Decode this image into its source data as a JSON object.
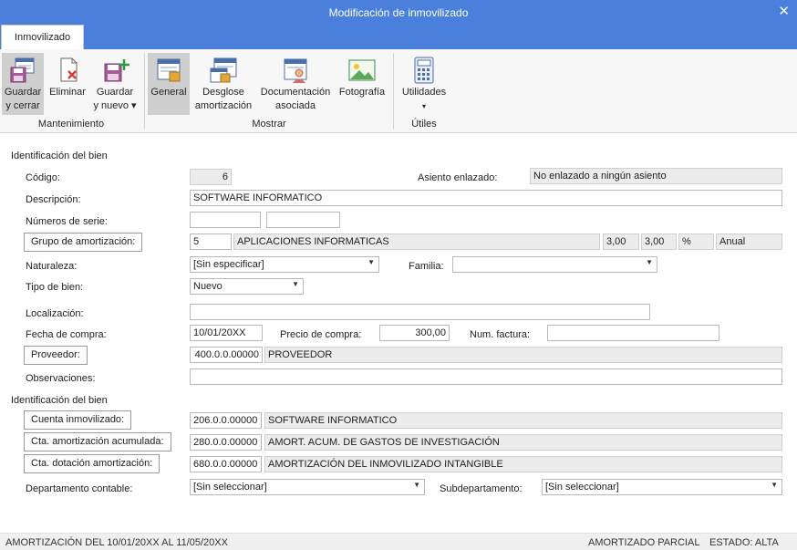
{
  "window": {
    "title": "Modificación de inmovilizado",
    "close_glyph": "✕"
  },
  "tabs": [
    {
      "label": "Inmovilizado"
    }
  ],
  "ribbon": {
    "groups": {
      "mantenimiento": "Mantenimiento",
      "mostrar": "Mostrar",
      "utiles": "Útiles"
    },
    "buttons": {
      "guardar_cerrar": {
        "line1": "Guardar",
        "line2": "y cerrar",
        "icon": "save-close-icon"
      },
      "eliminar": {
        "line1": "Eliminar",
        "icon": "delete-icon"
      },
      "guardar_nuevo": {
        "line1": "Guardar",
        "line2": "y nuevo ▾",
        "icon": "save-new-icon"
      },
      "general": {
        "line1": "General",
        "icon": "general-icon"
      },
      "desglose": {
        "line1": "Desglose",
        "line2": "amortización",
        "icon": "breakdown-icon"
      },
      "documentacion": {
        "line1": "Documentación",
        "line2": "asociada",
        "icon": "documents-icon"
      },
      "fotografia": {
        "line1": "Fotografía",
        "icon": "photo-icon"
      },
      "utilidades": {
        "line1": "Utilidades",
        "line2": "▾",
        "icon": "calculator-icon"
      }
    }
  },
  "form": {
    "section1": "Identificación del bien",
    "codigo": {
      "label": "Código:",
      "value": "6"
    },
    "asiento": {
      "label": "Asiento enlazado:",
      "value": "No enlazado a ningún asiento"
    },
    "descripcion": {
      "label": "Descripción:",
      "value": "SOFTWARE INFORMATICO"
    },
    "numeros_serie": {
      "label": "Números de serie:",
      "value1": "",
      "value2": ""
    },
    "grupo": {
      "button": "Grupo de amortización:",
      "code": "5",
      "name": "APLICACIONES INFORMATICAS",
      "v1": "3,00",
      "v2": "3,00",
      "unit": "%",
      "period": "Anual"
    },
    "naturaleza": {
      "label": "Naturaleza:",
      "value": "[Sin especificar]"
    },
    "familia": {
      "label": "Familia:",
      "value": ""
    },
    "tipo_bien": {
      "label": "Tipo de bien:",
      "value": "Nuevo"
    },
    "localizacion": {
      "label": "Localización:",
      "value": ""
    },
    "fecha_compra": {
      "label": "Fecha de compra:",
      "value": "10/01/20XX"
    },
    "precio_compra": {
      "label": "Precio de compra:",
      "value": "300,00"
    },
    "num_factura": {
      "label": "Num. factura:",
      "value": ""
    },
    "proveedor": {
      "button": "Proveedor:",
      "code": "400.0.0.00000",
      "name": "PROVEEDOR"
    },
    "observaciones": {
      "label": "Observaciones:",
      "value": ""
    },
    "section2": "Identificación del bien",
    "cuenta_inmovilizado": {
      "button": "Cuenta inmovilizado:",
      "code": "206.0.0.00000",
      "name": "SOFTWARE INFORMATICO"
    },
    "cta_amort_acum": {
      "button": "Cta. amortización acumulada:",
      "code": "280.0.0.00000",
      "name": "AMORT. ACUM. DE GASTOS DE INVESTIGACIÓN"
    },
    "cta_dotacion": {
      "button": "Cta. dotación amortización:",
      "code": "680.0.0.00000",
      "name": "AMORTIZACIÓN DEL INMOVILIZADO INTANGIBLE"
    },
    "departamento": {
      "label": "Departamento contable:",
      "value": "[Sin seleccionar]"
    },
    "subdepartamento": {
      "label": "Subdepartamento:",
      "value": "[Sin seleccionar]"
    }
  },
  "status": {
    "left": "AMORTIZACIÓN DEL 10/01/20XX AL 11/05/20XX",
    "middle": "AMORTIZADO PARCIAL",
    "right": "ESTADO: ALTA"
  },
  "colors": {
    "accent": "#4b7fdc",
    "active_button": "#cfcfcf",
    "readonly": "#ececec"
  }
}
